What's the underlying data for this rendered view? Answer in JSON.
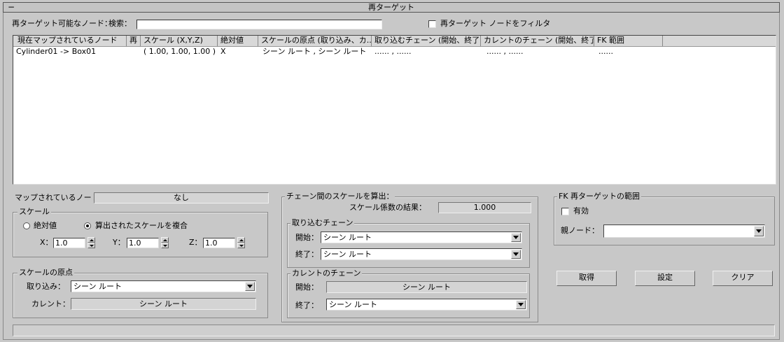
{
  "rollout": {
    "title": "再ターゲット",
    "collapse": "−"
  },
  "top": {
    "retargetable_label": "再ターゲット可能なノード：",
    "search_label": "検索：",
    "search_value": "",
    "filter_label": "再ターゲット ノードをフィルタ"
  },
  "table": {
    "columns": [
      "現在マップされているノード",
      "再",
      "スケール (X,Y,Z)",
      "絶対値",
      "スケールの原点 (取り込み、カ...",
      "取り込むチェーン (開始、終了)",
      "カレントのチェーン (開始、終了)",
      "FK 範囲"
    ],
    "rows": [
      [
        "Cylinder01 -> Box01",
        "",
        "( 1.00, 1.00, 1.00 )",
        "X",
        "シーン ルート , シーン ルート",
        "...... , ......",
        "...... , ......",
        "......"
      ]
    ]
  },
  "mapped": {
    "label": "マップされているノード：",
    "value": "なし"
  },
  "scale": {
    "title": "スケール",
    "absolute": "絶対値",
    "composite": "算出されたスケールを複合",
    "x_label": "X：",
    "x": "1.0",
    "y_label": "Y：",
    "y": "1.0",
    "z_label": "Z：",
    "z": "1.0"
  },
  "origin": {
    "title": "スケールの原点",
    "import_label": "取り込み：",
    "import_value": "シーン ルート",
    "current_label": "カレント：",
    "current_value": "シーン ルート"
  },
  "chain": {
    "title": "チェーン間のスケールを算出：",
    "result_label": "スケール係数の結果：",
    "result_value": "1.000",
    "import_title": "取り込むチェーン",
    "start_label": "開始：",
    "start_value": "シーン ルート",
    "end_label": "終了：",
    "end_value": "シーン ルート",
    "current_title": "カレントのチェーン",
    "cur_start_label": "開始：",
    "cur_start_value": "シーン ルート",
    "cur_end_label": "終了：",
    "cur_end_value": "シーン ルート"
  },
  "fk": {
    "title": "FK 再ターゲットの範囲",
    "enabled_label": "有効",
    "parent_label": "親ノード：",
    "parent_value": ""
  },
  "buttons": {
    "get": "取得",
    "set": "設定",
    "clear": "クリア"
  }
}
